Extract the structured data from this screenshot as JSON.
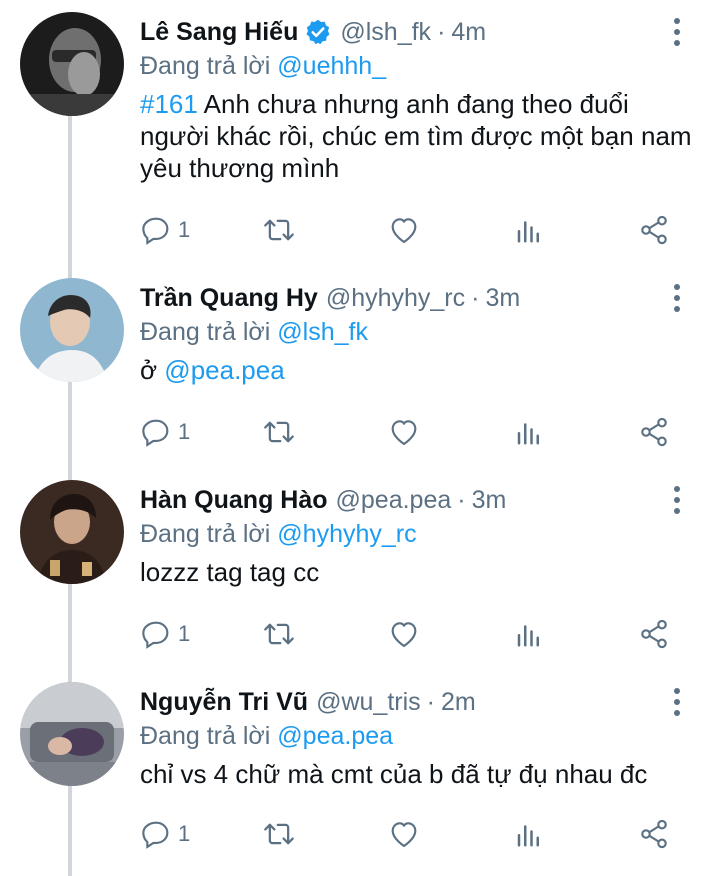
{
  "colors": {
    "accent": "#1d9bf0",
    "muted": "#5b7083",
    "thread_line": "#d0d6db"
  },
  "tweets": [
    {
      "name": "Lê Sang Hiếu",
      "verified": true,
      "handle": "@lsh_fk",
      "sep": "·",
      "time": "4m",
      "reply_prefix": "Đang trả lời",
      "reply_to": "@uehhh_",
      "tag": "#161",
      "text": "Anh chưa nhưng anh đang theo đuổi người khác rồi, chúc em tìm được một bạn nam yêu thương mình",
      "reply_count": "1",
      "icons": [
        "reply-icon",
        "retweet-icon",
        "like-icon",
        "analytics-icon",
        "share-icon"
      ]
    },
    {
      "name": "Trần Quang Hy",
      "verified": false,
      "handle": "@hyhyhy_rc",
      "sep": "·",
      "time": "3m",
      "reply_prefix": "Đang trả lời",
      "reply_to": "@lsh_fk",
      "prefix": "ở",
      "mention": "@pea.pea",
      "reply_count": "1"
    },
    {
      "name": "Hàn Quang Hào",
      "verified": false,
      "handle": "@pea.pea",
      "sep": "·",
      "time": "3m",
      "reply_prefix": "Đang trả lời",
      "reply_to": "@hyhyhy_rc",
      "text": "lozzz tag tag cc",
      "reply_count": "1"
    },
    {
      "name": "Nguyễn Tri Vũ",
      "verified": false,
      "handle": "@wu_tris",
      "sep": "·",
      "time": "2m",
      "reply_prefix": "Đang trả lời",
      "reply_to": "@pea.pea",
      "text": "chỉ vs 4 chữ mà cmt của b đã tự đụ nhau đc",
      "reply_count": "1"
    }
  ]
}
